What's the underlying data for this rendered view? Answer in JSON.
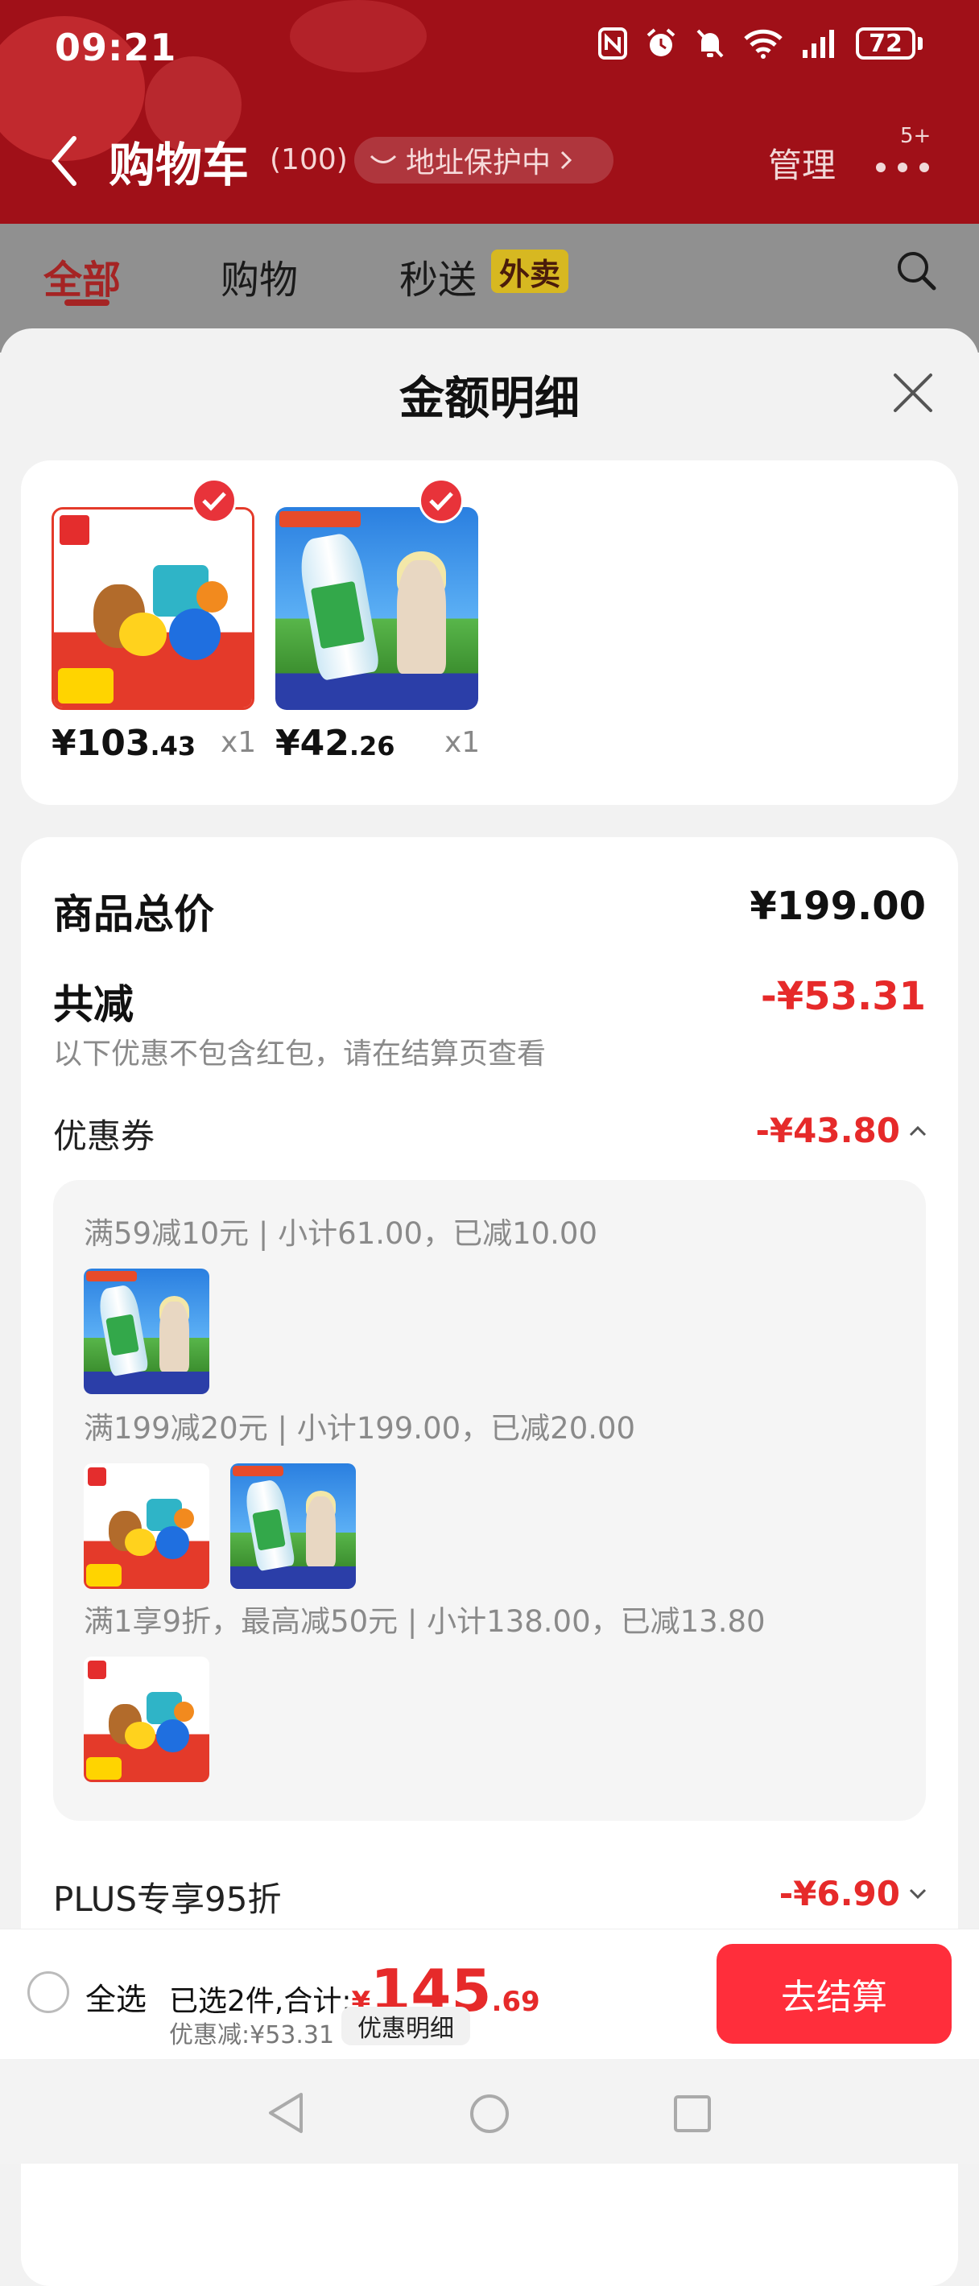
{
  "status_bar": {
    "time": "09:21",
    "battery": "72",
    "icons": [
      "nfc-icon",
      "alarm-icon",
      "mute-icon",
      "wifi-icon",
      "signal-icon",
      "battery-icon"
    ]
  },
  "nav": {
    "title": "购物车",
    "count": "(100)",
    "address_label": "地址保护中",
    "manage_label": "管理",
    "badge": "5+"
  },
  "tabs": {
    "all": "全部",
    "shopping": "购物",
    "express": "秒送",
    "waimai": "外卖"
  },
  "sheet": {
    "title": "金额明细",
    "products": [
      {
        "price_int": "¥103",
        "price_dec": ".43",
        "qty": "x1"
      },
      {
        "price_int": "¥42",
        "price_dec": ".26",
        "qty": "x1"
      }
    ],
    "total_label": "商品总价",
    "total_value": "¥199.00",
    "reduce_label": "共减",
    "reduce_value": "-¥53.31",
    "reduce_note": "以下优惠不包含红包，请在结算页查看",
    "coupon_label": "优惠券",
    "coupon_value": "-¥43.80",
    "coupon_lines": [
      "满59减10元 | 小计61.00，已减10.00",
      "满199减20元 | 小计199.00，已减20.00",
      "满1享9折，最高减50元 | 小计138.00，已减13.80"
    ],
    "plus_label": "PLUS专享95折",
    "plus_value": "-¥6.90"
  },
  "bottom": {
    "select_all": "全选",
    "summary_prefix": "已选2件,合计:",
    "yen": "¥",
    "total_int": "145",
    "total_dec": ".69",
    "discount": "优惠减:¥53.31",
    "detail_btn": "优惠明细",
    "checkout": "去结算"
  },
  "colors": {
    "header_red": "#a01018",
    "accent_red": "#e62a2a",
    "checkout_red": "#ff2e3b",
    "waimai_yellow": "#d7b821"
  }
}
